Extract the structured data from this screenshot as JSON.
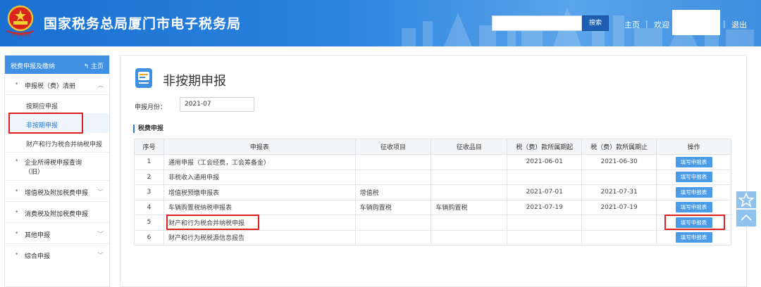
{
  "header": {
    "title": "国家税务总局厦门市电子税务局",
    "search_placeholder": "",
    "search_label": "搜索",
    "home_link": "主页",
    "welcome": "欢迎",
    "logout": "退出",
    "emblem_script": "字体税收"
  },
  "sidebar": {
    "header_title": "税费申报及缴纳",
    "home_label": "主页",
    "items": [
      {
        "label": "申报税（费）清册",
        "expanded": true
      },
      {
        "label": "企业所得税申报查询",
        "label2": "（旧）"
      },
      {
        "label": "增值税及附加税费申报"
      },
      {
        "label": "消费税及附加税费申报"
      },
      {
        "label": "其他申报"
      },
      {
        "label": "综合申报"
      }
    ],
    "subitems": [
      {
        "label": "按期应申报"
      },
      {
        "label": "非按期申报",
        "active": true
      },
      {
        "label": "财产和行为税合并纳税申报"
      }
    ]
  },
  "main": {
    "page_title": "非按期申报",
    "month_label": "申报月份：",
    "month_value": "2021-07",
    "section_title": "税费申报",
    "table": {
      "headers": [
        "序号",
        "申报表",
        "征收项目",
        "征收品目",
        "税（费）款所属期起",
        "税（费）款所属期止",
        "操作"
      ],
      "rows": [
        {
          "no": "1",
          "form": "通用申报（工会经费，工会筹备金）",
          "item": "",
          "subitem": "",
          "start": "2021-06-01",
          "end": "2021-06-30",
          "action": "填写申报表"
        },
        {
          "no": "2",
          "form": "非税收入通用申报",
          "item": "",
          "subitem": "",
          "start": "",
          "end": "",
          "action": "填写申报表"
        },
        {
          "no": "3",
          "form": "增值税预缴申报表",
          "item": "增值税",
          "subitem": "",
          "start": "2021-07-01",
          "end": "2021-07-31",
          "action": "填写申报表"
        },
        {
          "no": "4",
          "form": "车辆购置税纳税申报表",
          "item": "车辆购置税",
          "subitem": "车辆购置税",
          "start": "2021-07-19",
          "end": "2021-07-19",
          "action": "填写申报表"
        },
        {
          "no": "5",
          "form": "财产和行为税合并纳税申报",
          "item": "",
          "subitem": "",
          "start": "",
          "end": "",
          "action": "填写申报表"
        },
        {
          "no": "6",
          "form": "财产和行为税税源信息报告",
          "item": "",
          "subitem": "",
          "start": "",
          "end": "",
          "action": "填写申报表"
        }
      ]
    }
  },
  "colors": {
    "header_blue": "#2b84e0",
    "sidebar_header": "#3f8fe3",
    "action_button": "#4a9be8",
    "highlight_red": "#e0201f",
    "active_text": "#2a7bd4"
  },
  "icons": {
    "emblem": "national-emblem-icon",
    "home": "home-arrow-icon",
    "page": "form-document-icon",
    "favorite": "star-icon",
    "scroll_top": "chevron-up-icon"
  }
}
